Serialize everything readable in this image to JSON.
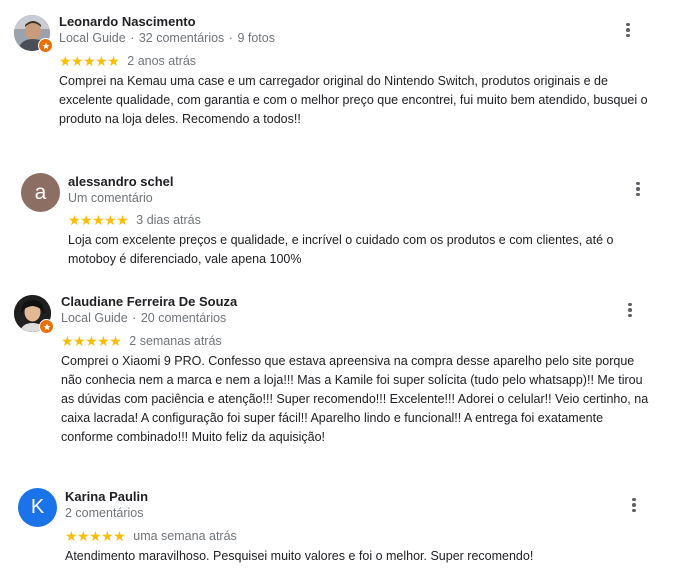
{
  "reviews": [
    {
      "name": "Leonardo Nascimento",
      "local_guide": "Local Guide",
      "reviews_count": "32 comentários",
      "photos_count": "9 fotos",
      "stars": 5,
      "date": "2 anos atrás",
      "text": "Comprei na Kemau uma case e um carregador original do Nintendo Switch, produtos originais e de excelente qualidade, com garantia e com o melhor preço que encontrei, fui muito bem atendido, busquei o produto na loja deles. Recomendo a todos!!"
    },
    {
      "name": "alessandro schel",
      "avatar_letter": "a",
      "avatar_color": "#8d6e63",
      "reviews_count": "Um comentário",
      "stars": 5,
      "date": "3 dias atrás",
      "text": "Loja com excelente preços e qualidade, e incrível o cuidado com os produtos e com clientes, até o motoboy é diferenciado, vale apena 100%"
    },
    {
      "name": "Claudiane Ferreira De Souza",
      "local_guide": "Local Guide",
      "reviews_count": "20 comentários",
      "stars": 5,
      "date": "2 semanas atrás",
      "text": "Comprei o Xiaomi 9 PRO. Confesso que estava apreensiva na compra desse aparelho pelo site porque não conhecia nem a marca e nem a loja!!! Mas a Kamile foi super solícita (tudo pelo whatsapp)!! Me tirou as dúvidas com paciência e atenção!!! Super recomendo!!!  Excelente!!! Adorei o celular!! Veio certinho, na caixa lacrada! A configuração foi super fácil!! Aparelho lindo e funcional!! A entrega foi exatamente conforme combinado!!! Muito feliz da aquisição!"
    },
    {
      "name": "Karina Paulin",
      "avatar_letter": "K",
      "avatar_color": "#1a73e8",
      "reviews_count": "2 comentários",
      "stars": 5,
      "date": "uma semana atrás",
      "text": "Atendimento maravilhoso. Pesquisei muito valores e foi o melhor. Super recomendo!"
    }
  ],
  "star_glyph": "★★★★★",
  "colors": {
    "star": "#fbbc04",
    "local_guide_badge": "#e8710a",
    "meta_text": "#70757a",
    "name_text": "#202124"
  }
}
